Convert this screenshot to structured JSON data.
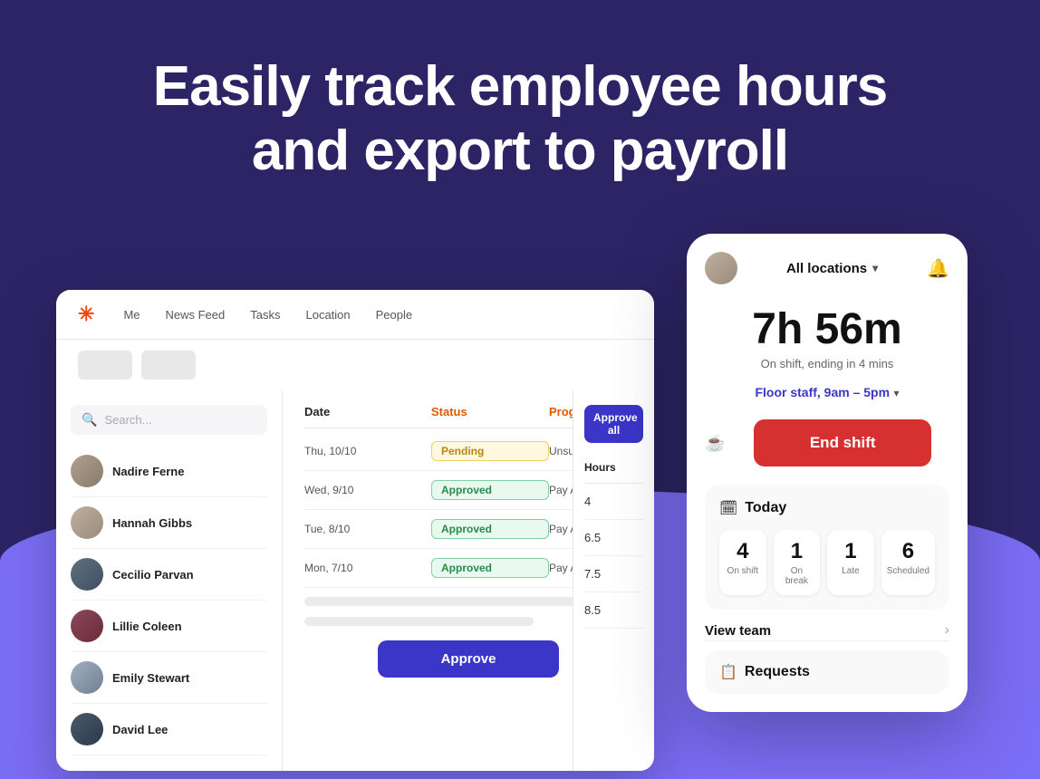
{
  "hero": {
    "line1": "Easily track employee hours",
    "line2": "and export to payroll"
  },
  "nav": {
    "logo": "✳",
    "items": [
      "Me",
      "News Feed",
      "Tasks",
      "Location",
      "People"
    ]
  },
  "toolbar": {
    "buttons": [
      "",
      ""
    ]
  },
  "table": {
    "columns": [
      "Date",
      "Status",
      "Progress"
    ],
    "rows": [
      {
        "name": "Nadire Ferne",
        "date": "Thu, 10/10",
        "status": "Pending",
        "statusType": "pending",
        "progress": "Unsubmitted",
        "hours": "4"
      },
      {
        "name": "Hannah Gibbs",
        "date": "Wed, 9/10",
        "status": "Approved",
        "statusType": "approved",
        "progress": "Pay Approved",
        "hours": "6.5"
      },
      {
        "name": "Cecilio Parvan",
        "date": "Tue, 8/10",
        "status": "Approved",
        "statusType": "approved",
        "progress": "Pay Approved",
        "hours": "7.5"
      },
      {
        "name": "Lillie Coleen",
        "date": "Mon, 7/10",
        "status": "Approved",
        "statusType": "approved",
        "progress": "Pay Approved",
        "hours": "8.5"
      }
    ],
    "extra_employees": [
      "Emily Stewart",
      "David Lee"
    ],
    "hours_header": "Hours",
    "approve_all_label": "Approve all",
    "approve_label": "Approve"
  },
  "mobile": {
    "location": "All locations",
    "time": "7h 56m",
    "subtitle": "On shift, ending in 4 mins",
    "shift": "Floor staff, 9am – 5pm",
    "end_shift": "End shift",
    "today_label": "Today",
    "stats": [
      {
        "number": "4",
        "label": "On shift"
      },
      {
        "number": "1",
        "label": "On break"
      },
      {
        "number": "1",
        "label": "Late"
      },
      {
        "number": "6",
        "label": "Scheduled"
      }
    ],
    "view_team": "View team",
    "requests": "Requests"
  }
}
